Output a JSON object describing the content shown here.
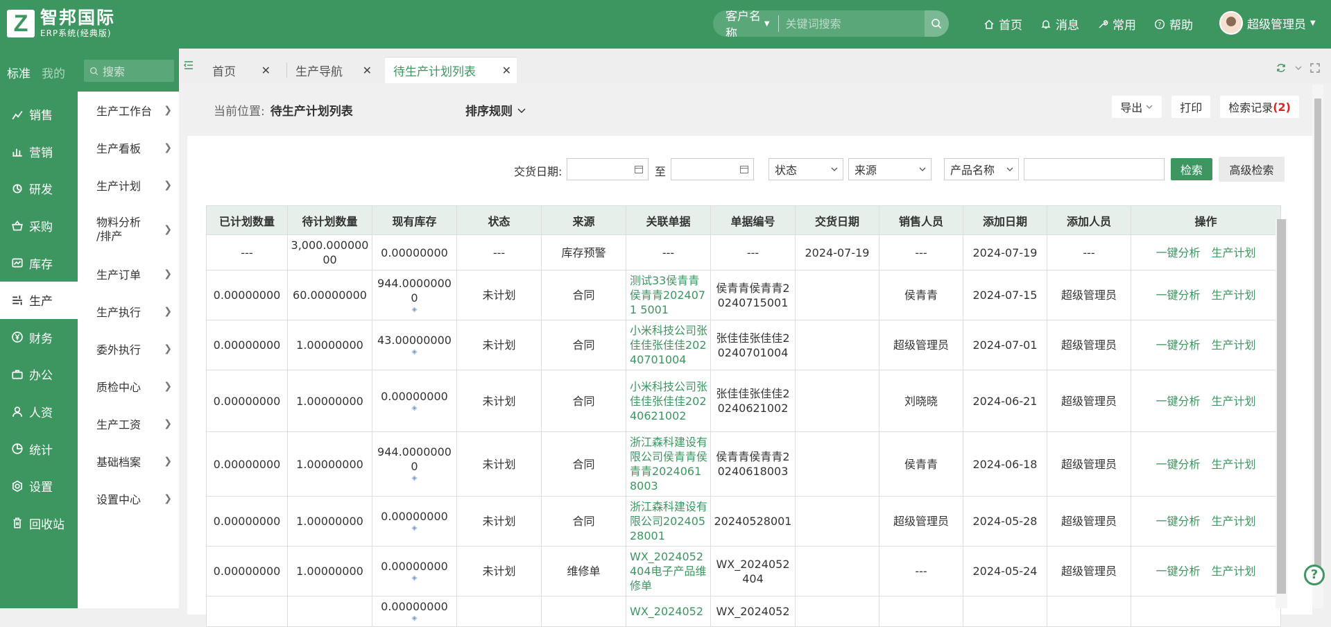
{
  "brand": {
    "logo_letter": "Z",
    "title": "智邦国际",
    "subtitle": "ERP系统(经典版)"
  },
  "search": {
    "type_label": "客户名称",
    "placeholder": "关键词搜索"
  },
  "top_nav": [
    {
      "label": "首页",
      "icon": "home-icon"
    },
    {
      "label": "消息",
      "icon": "bell-icon"
    },
    {
      "label": "常用",
      "icon": "tool-icon"
    },
    {
      "label": "帮助",
      "icon": "help-icon"
    }
  ],
  "user": {
    "name": "超级管理员"
  },
  "sidebar": {
    "tabs": [
      "标准",
      "我的"
    ],
    "search_placeholder": "搜索",
    "items": [
      {
        "label": "销售",
        "icon": "chart-icon"
      },
      {
        "label": "营销",
        "icon": "bar-chart-icon"
      },
      {
        "label": "研发",
        "icon": "research-icon"
      },
      {
        "label": "采购",
        "icon": "basket-icon"
      },
      {
        "label": "库存",
        "icon": "inventory-icon"
      },
      {
        "label": "生产",
        "icon": "production-icon",
        "active": true
      },
      {
        "label": "财务",
        "icon": "yen-icon"
      },
      {
        "label": "办公",
        "icon": "briefcase-icon"
      },
      {
        "label": "人资",
        "icon": "person-icon"
      },
      {
        "label": "统计",
        "icon": "pie-icon"
      },
      {
        "label": "设置",
        "icon": "gear-icon"
      },
      {
        "label": "回收站",
        "icon": "trash-icon"
      }
    ]
  },
  "submenu": [
    "生产工作台",
    "生产看板",
    "生产计划",
    "物料分析\n/排产",
    "生产订单",
    "生产执行",
    "委外执行",
    "质检中心",
    "生产工资",
    "基础档案",
    "设置中心"
  ],
  "tabs": [
    {
      "label": "首页"
    },
    {
      "label": "生产导航"
    },
    {
      "label": "待生产计划列表",
      "active": true
    }
  ],
  "page": {
    "crumb_label": "当前位置:",
    "crumb_value": "待生产计划列表",
    "sort_rule": "排序规则",
    "export": "导出",
    "print": "打印",
    "search_records": "检索记录",
    "search_records_count": "(2)"
  },
  "filters": {
    "delivery_date_label": "交货日期:",
    "to_label": "至",
    "status_placeholder": "状态",
    "source_placeholder": "来源",
    "product_name_select": "产品名称",
    "search_button": "检索",
    "advanced_button": "高级检索"
  },
  "table": {
    "columns": [
      "已计划数量",
      "待计划数量",
      "现有库存",
      "状态",
      "来源",
      "关联单据",
      "单据编号",
      "交货日期",
      "销售人员",
      "添加日期",
      "添加人员",
      "操作"
    ],
    "actions": [
      "一键分析",
      "生产计划"
    ],
    "rows": [
      {
        "planned": "---",
        "pending": "3,000.000000\n00",
        "stock": "0.00000000",
        "status": "---",
        "source": "库存预警",
        "related": "---",
        "doc_no": "---",
        "delivery": "2024-07-19",
        "sales": "---",
        "added": "2024-07-19",
        "adder": "---"
      },
      {
        "planned": "0.00000000",
        "pending": "60.00000000",
        "stock": "944.0000000\n0",
        "status": "未计划",
        "source": "合同",
        "related": "测试33侯青青侯青青2024071 5001",
        "doc_no": "侯青青侯青青20240715001",
        "delivery": "",
        "sales": "侯青青",
        "added": "2024-07-15",
        "adder": "超级管理员"
      },
      {
        "planned": "0.00000000",
        "pending": "1.00000000",
        "stock": "43.00000000",
        "status": "未计划",
        "source": "合同",
        "related": "小米科技公司张佳佳张佳佳20240701004",
        "doc_no": "张佳佳张佳佳20240701004",
        "delivery": "",
        "sales": "超级管理员",
        "added": "2024-07-01",
        "adder": "超级管理员"
      },
      {
        "planned": "0.00000000",
        "pending": "1.00000000",
        "stock": "0.00000000",
        "status": "未计划",
        "source": "合同",
        "related": "小米科技公司张佳佳张佳佳20240621002",
        "doc_no": "张佳佳张佳佳20240621002",
        "delivery": "",
        "sales": "刘晓晓",
        "added": "2024-06-21",
        "adder": "超级管理员"
      },
      {
        "planned": "0.00000000",
        "pending": "1.00000000",
        "stock": "944.0000000\n0",
        "status": "未计划",
        "source": "合同",
        "related": "浙江森科建设有限公司侯青青侯青青20240618003",
        "doc_no": "侯青青侯青青20240618003",
        "delivery": "",
        "sales": "侯青青",
        "added": "2024-06-18",
        "adder": "超级管理员"
      },
      {
        "planned": "0.00000000",
        "pending": "1.00000000",
        "stock": "0.00000000",
        "status": "未计划",
        "source": "合同",
        "related": "浙江森科建设有限公司20240528001",
        "doc_no": "20240528001",
        "delivery": "",
        "sales": "超级管理员",
        "added": "2024-05-28",
        "adder": "超级管理员"
      },
      {
        "planned": "0.00000000",
        "pending": "1.00000000",
        "stock": "0.00000000",
        "status": "未计划",
        "source": "维修单",
        "related": "WX_2024052404电子产品维修单",
        "doc_no": "WX_2024052404",
        "delivery": "",
        "sales": "---",
        "added": "2024-05-24",
        "adder": "超级管理员"
      },
      {
        "planned": "",
        "pending": "",
        "stock": "0.00000000",
        "status": "",
        "source": "",
        "related": "WX_2024052",
        "doc_no": "WX_2024052",
        "delivery": "",
        "sales": "",
        "added": "",
        "adder": ""
      }
    ]
  }
}
